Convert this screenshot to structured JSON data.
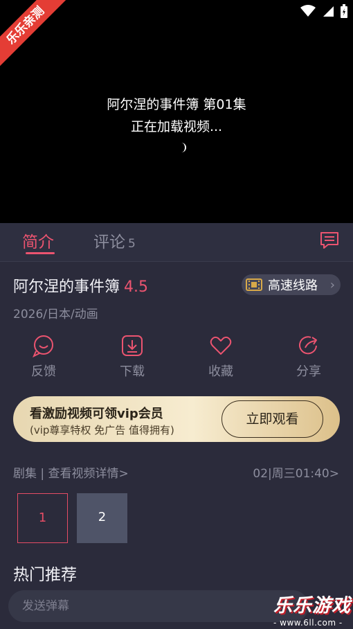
{
  "watermark_ribbon": "乐乐亲测",
  "player": {
    "episode_title": "阿尔涅的事件簿 第01集",
    "loading_text": "正在加载视频..."
  },
  "tabs": {
    "intro_label": "简介",
    "comment_label": "评论",
    "comment_count": "5"
  },
  "show": {
    "title": "阿尔涅的事件簿",
    "rating": "4.5",
    "route_label": "高速线路",
    "meta": "2026/日本/动画"
  },
  "actions": [
    {
      "label": "反馈",
      "icon": "feedback-icon"
    },
    {
      "label": "下载",
      "icon": "download-icon"
    },
    {
      "label": "收藏",
      "icon": "heart-icon"
    },
    {
      "label": "分享",
      "icon": "share-icon"
    }
  ],
  "promo": {
    "title": "看激励视频可领vip会员",
    "subtitle": "(vip尊享特权 免广告 值得拥有)",
    "button_label": "立即观看"
  },
  "episodes": {
    "header": "剧集 | 查看视频详情>",
    "schedule": "02|周三01:40>",
    "items": [
      "1",
      "2"
    ],
    "selected": "1"
  },
  "recommend_title": "热门推荐",
  "danmaku": {
    "placeholder": "发送弹幕"
  },
  "site_watermark": {
    "logo": "乐乐游戏",
    "url": "- www.6ll.com -"
  },
  "colors": {
    "accent": "#ec5470",
    "background": "#2b2b3b",
    "promo_gold": "#e7d7b1"
  }
}
